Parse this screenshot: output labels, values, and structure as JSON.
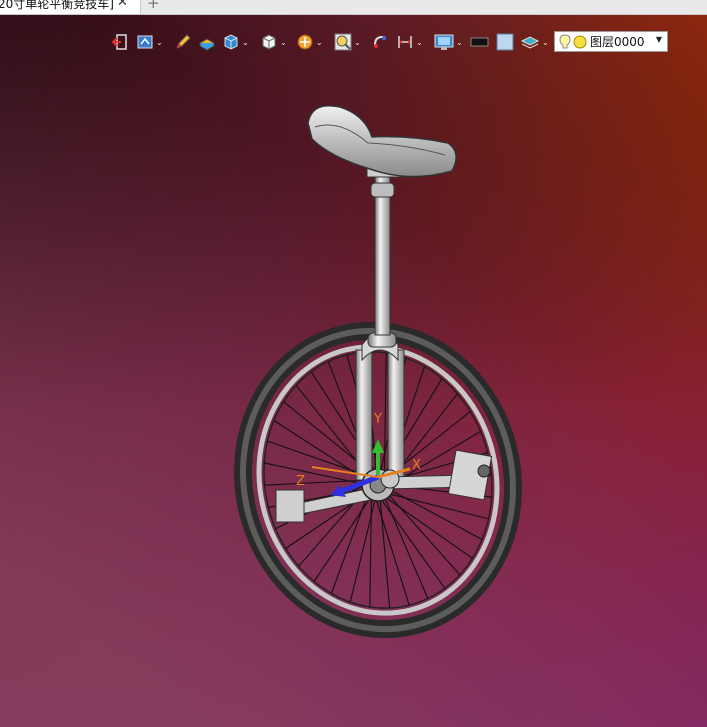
{
  "tab": {
    "title": "20寸单轮平衡竞技车]",
    "close_glyph": "✕",
    "add_glyph": "+"
  },
  "toolbar": {
    "icons": [
      "exit-sketch-icon",
      "view-orientation-icon",
      "pencil-icon",
      "box-layers-icon",
      "cube-display-icon",
      "cube-view-icon",
      "render-mode-icon",
      "zoom-icon",
      "snap-icon",
      "dimension-icon",
      "monitor-icon",
      "black-rect-icon",
      "light-square-icon",
      "layers-stack-icon"
    ],
    "layer_selector": {
      "value": "图层0000"
    }
  },
  "viewport": {
    "bg_top_left": "#2a0a12",
    "bg_top_right": "#9a2a04",
    "bg_bottom_left": "#7a1a6a",
    "bg_bottom_right": "#8a4454"
  },
  "triad": {
    "x_label": "X",
    "z_label": "Z",
    "y_label": "Y",
    "x_color": "#e88020",
    "y_color": "#30c030",
    "z_color": "#3030e0"
  }
}
